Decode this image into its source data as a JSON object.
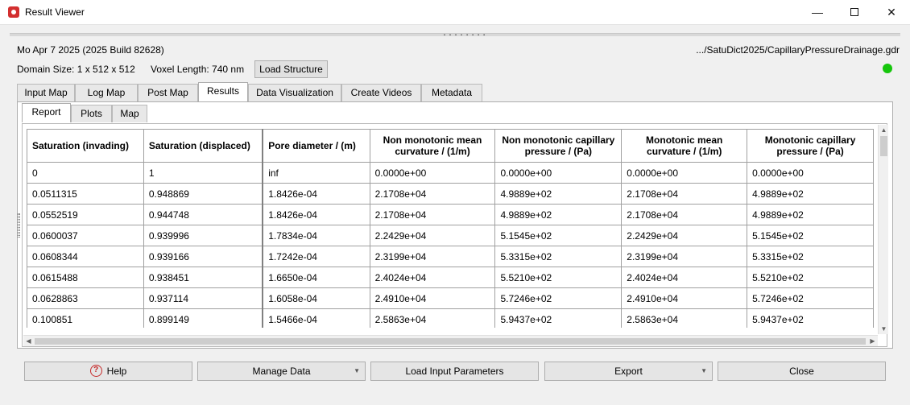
{
  "window": {
    "title": "Result Viewer",
    "minimize_glyph": "—",
    "close_glyph": "✕"
  },
  "splitter_handle": "........",
  "header": {
    "build_info": "Mo Apr 7 2025 (2025 Build 82628)",
    "file_path": ".../SatuDict2025/CapillaryPressureDrainage.gdr",
    "domain_size": "Domain Size: 1 x 512 x 512",
    "voxel_length": "Voxel Length: 740 nm",
    "load_structure_label": "Load Structure",
    "status_color": "#16c60c"
  },
  "main_tabs": [
    {
      "label": "Input Map"
    },
    {
      "label": "Log Map"
    },
    {
      "label": "Post Map"
    },
    {
      "label": "Results",
      "active": true
    },
    {
      "label": "Data Visualization"
    },
    {
      "label": "Create Videos"
    },
    {
      "label": "Metadata"
    }
  ],
  "sub_tabs": [
    {
      "label": "Report",
      "active": true
    },
    {
      "label": "Plots"
    },
    {
      "label": "Map"
    }
  ],
  "table": {
    "columns": [
      "Saturation (invading)",
      "Saturation (displaced)",
      "Pore diameter / (m)",
      "Non monotonic mean curvature / (1/m)",
      "Non monotonic capillary pressure / (Pa)",
      "Monotonic mean curvature / (1/m)",
      "Monotonic capillary pressure / (Pa)"
    ],
    "rows": [
      [
        "0",
        "1",
        "inf",
        "0.0000e+00",
        "0.0000e+00",
        "0.0000e+00",
        "0.0000e+00"
      ],
      [
        "0.0511315",
        "0.948869",
        "1.8426e-04",
        "2.1708e+04",
        "4.9889e+02",
        "2.1708e+04",
        "4.9889e+02"
      ],
      [
        "0.0552519",
        "0.944748",
        "1.8426e-04",
        "2.1708e+04",
        "4.9889e+02",
        "2.1708e+04",
        "4.9889e+02"
      ],
      [
        "0.0600037",
        "0.939996",
        "1.7834e-04",
        "2.2429e+04",
        "5.1545e+02",
        "2.2429e+04",
        "5.1545e+02"
      ],
      [
        "0.0608344",
        "0.939166",
        "1.7242e-04",
        "2.3199e+04",
        "5.3315e+02",
        "2.3199e+04",
        "5.3315e+02"
      ],
      [
        "0.0615488",
        "0.938451",
        "1.6650e-04",
        "2.4024e+04",
        "5.5210e+02",
        "2.4024e+04",
        "5.5210e+02"
      ],
      [
        "0.0628863",
        "0.937114",
        "1.6058e-04",
        "2.4910e+04",
        "5.7246e+02",
        "2.4910e+04",
        "5.7246e+02"
      ],
      [
        "0.100851",
        "0.899149",
        "1.5466e-04",
        "2.5863e+04",
        "5.9437e+02",
        "2.5863e+04",
        "5.9437e+02"
      ],
      [
        "",
        "",
        "",
        "",
        "",
        "",
        ""
      ]
    ]
  },
  "buttons": {
    "help": "Help",
    "help_icon_glyph": "?",
    "manage_data": "Manage Data",
    "load_input_parameters": "Load Input Parameters",
    "export": "Export",
    "close": "Close"
  },
  "icons": {
    "app": "app-logo-icon",
    "help": "help-circle-icon",
    "dropdown": "caret-down-icon",
    "scroll_up": "arrow-up-icon",
    "scroll_down": "arrow-down-icon",
    "scroll_left": "arrow-left-icon",
    "scroll_right": "arrow-right-icon"
  }
}
